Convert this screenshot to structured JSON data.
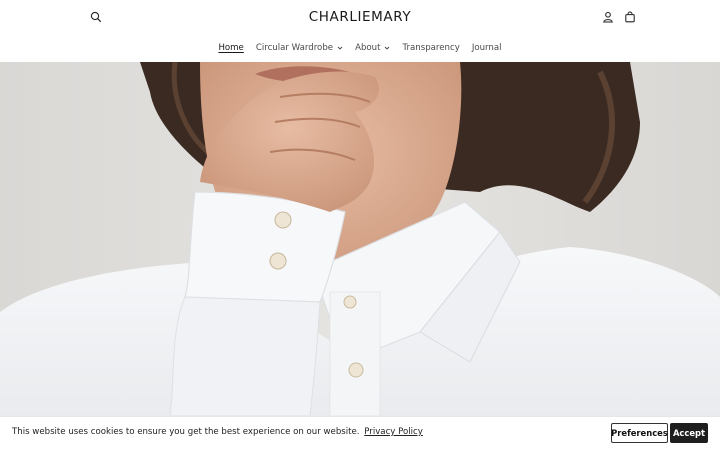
{
  "header": {
    "logo": "CHARLIEMARY",
    "search_icon": "search-icon",
    "account_icon": "user-icon",
    "cart_icon": "shopping-bag-icon"
  },
  "nav": {
    "items": [
      {
        "label": "Home",
        "active": true,
        "dropdown": false
      },
      {
        "label": "Circular Wardrobe",
        "active": false,
        "dropdown": true
      },
      {
        "label": "About",
        "active": false,
        "dropdown": true
      },
      {
        "label": "Transparency",
        "active": false,
        "dropdown": false
      },
      {
        "label": "Journal",
        "active": false,
        "dropdown": false
      }
    ]
  },
  "hero": {
    "image_description": "woman in white shirt"
  },
  "cookie": {
    "text": "This website uses cookies to ensure you get the best experience on our website.",
    "link": "Privacy Policy",
    "preferences": "Preferences",
    "accept": "Accept"
  },
  "colors": {
    "background": "#ffffff",
    "text": "#1c1c1c",
    "accept_bg": "#1e1e1e",
    "hero_bg": "#e4e2df",
    "shirt": "#f2f3f5"
  }
}
